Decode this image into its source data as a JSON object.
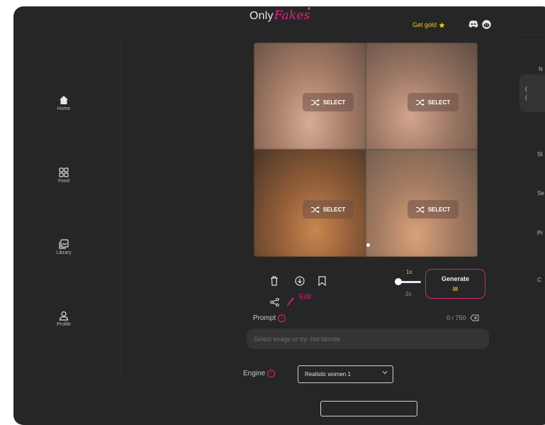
{
  "sidebar": {
    "items": [
      {
        "label": "Home",
        "icon": "home-icon"
      },
      {
        "label": "Feed",
        "icon": "grid-icon"
      },
      {
        "label": "Library",
        "icon": "library-icon"
      },
      {
        "label": "Profile",
        "icon": "profile-icon"
      }
    ]
  },
  "header": {
    "logo_prefix": "Only",
    "logo_suffix": "Fakes",
    "gold_label": "Get gold"
  },
  "grid": {
    "select_label": "SELECT",
    "tiles": 4
  },
  "actions": {
    "edit_label": "Edit",
    "multiplier_selected": "1x",
    "multiplier_max": "2x",
    "generate_label": "Generate"
  },
  "prompt": {
    "label": "Prompt",
    "counter": "0 / 750",
    "placeholder": "Select image or try: hot blonde",
    "value": ""
  },
  "engine": {
    "label": "Engine",
    "selected": "Realistic women 1"
  },
  "right_panel": {
    "labels": [
      "N",
      "St",
      "Se",
      "Pr",
      "C"
    ],
    "card_lines": [
      "(",
      "("
    ]
  },
  "colors": {
    "background": "#262626",
    "accent_pink": "#e0247f",
    "gold": "#f3c623",
    "input_bg": "#343434"
  }
}
